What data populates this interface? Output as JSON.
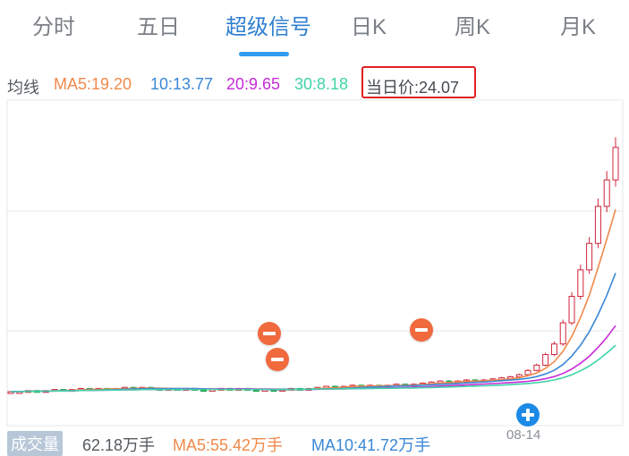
{
  "tabs": [
    {
      "label": "分时",
      "active": false
    },
    {
      "label": "五日",
      "active": false
    },
    {
      "label": "超级信号",
      "active": true
    },
    {
      "label": "日K",
      "active": false
    },
    {
      "label": "周K",
      "active": false
    },
    {
      "label": "月K",
      "active": false
    }
  ],
  "ma_legend": {
    "title": "均线",
    "ma5": "MA5:19.20",
    "ma10": "10:13.77",
    "ma20": "20:9.65",
    "ma30": "30:8.18",
    "current_price": "当日价:24.07"
  },
  "volume_legend": {
    "label": "成交量",
    "value": "62.18万手",
    "ma5": "MA5:55.42万手",
    "ma10": "MA10:41.72万手"
  },
  "date_label": "08-14",
  "colors": {
    "accent": "#2f7fd0",
    "ma5": "#f0894a",
    "ma10": "#3a87d6",
    "ma20": "#c62ad6",
    "ma30": "#3fd3a8",
    "up": "#d0243a",
    "down": "#1aa34a",
    "price_box": "#e02020"
  },
  "chart_data": {
    "type": "line",
    "title": "",
    "xlabel": "",
    "ylabel": "",
    "close": [
      1.0,
      1.0,
      1.1,
      1.0,
      1.1,
      1.2,
      1.1,
      1.2,
      1.3,
      1.2,
      1.3,
      1.2,
      1.3,
      1.4,
      1.3,
      1.4,
      1.3,
      1.2,
      1.3,
      1.2,
      1.3,
      1.2,
      1.1,
      1.2,
      1.3,
      1.2,
      1.3,
      1.2,
      1.1,
      1.2,
      1.1,
      1.2,
      1.3,
      1.2,
      1.3,
      1.4,
      1.5,
      1.4,
      1.5,
      1.6,
      1.5,
      1.6,
      1.5,
      1.6,
      1.7,
      1.6,
      1.7,
      1.8,
      1.9,
      2.0,
      1.9,
      2.0,
      2.1,
      2.0,
      2.1,
      2.2,
      2.3,
      2.4,
      2.6,
      3.0,
      3.5,
      4.5,
      5.5,
      7.5,
      10.0,
      12.5,
      15.0,
      18.5,
      21.0,
      24.07
    ],
    "series": [
      {
        "name": "MA5",
        "last": 19.2
      },
      {
        "name": "MA10",
        "last": 13.77
      },
      {
        "name": "MA20",
        "last": 9.65
      },
      {
        "name": "MA30",
        "last": 8.18
      }
    ],
    "ylim": [
      0,
      28
    ],
    "grid": true
  }
}
